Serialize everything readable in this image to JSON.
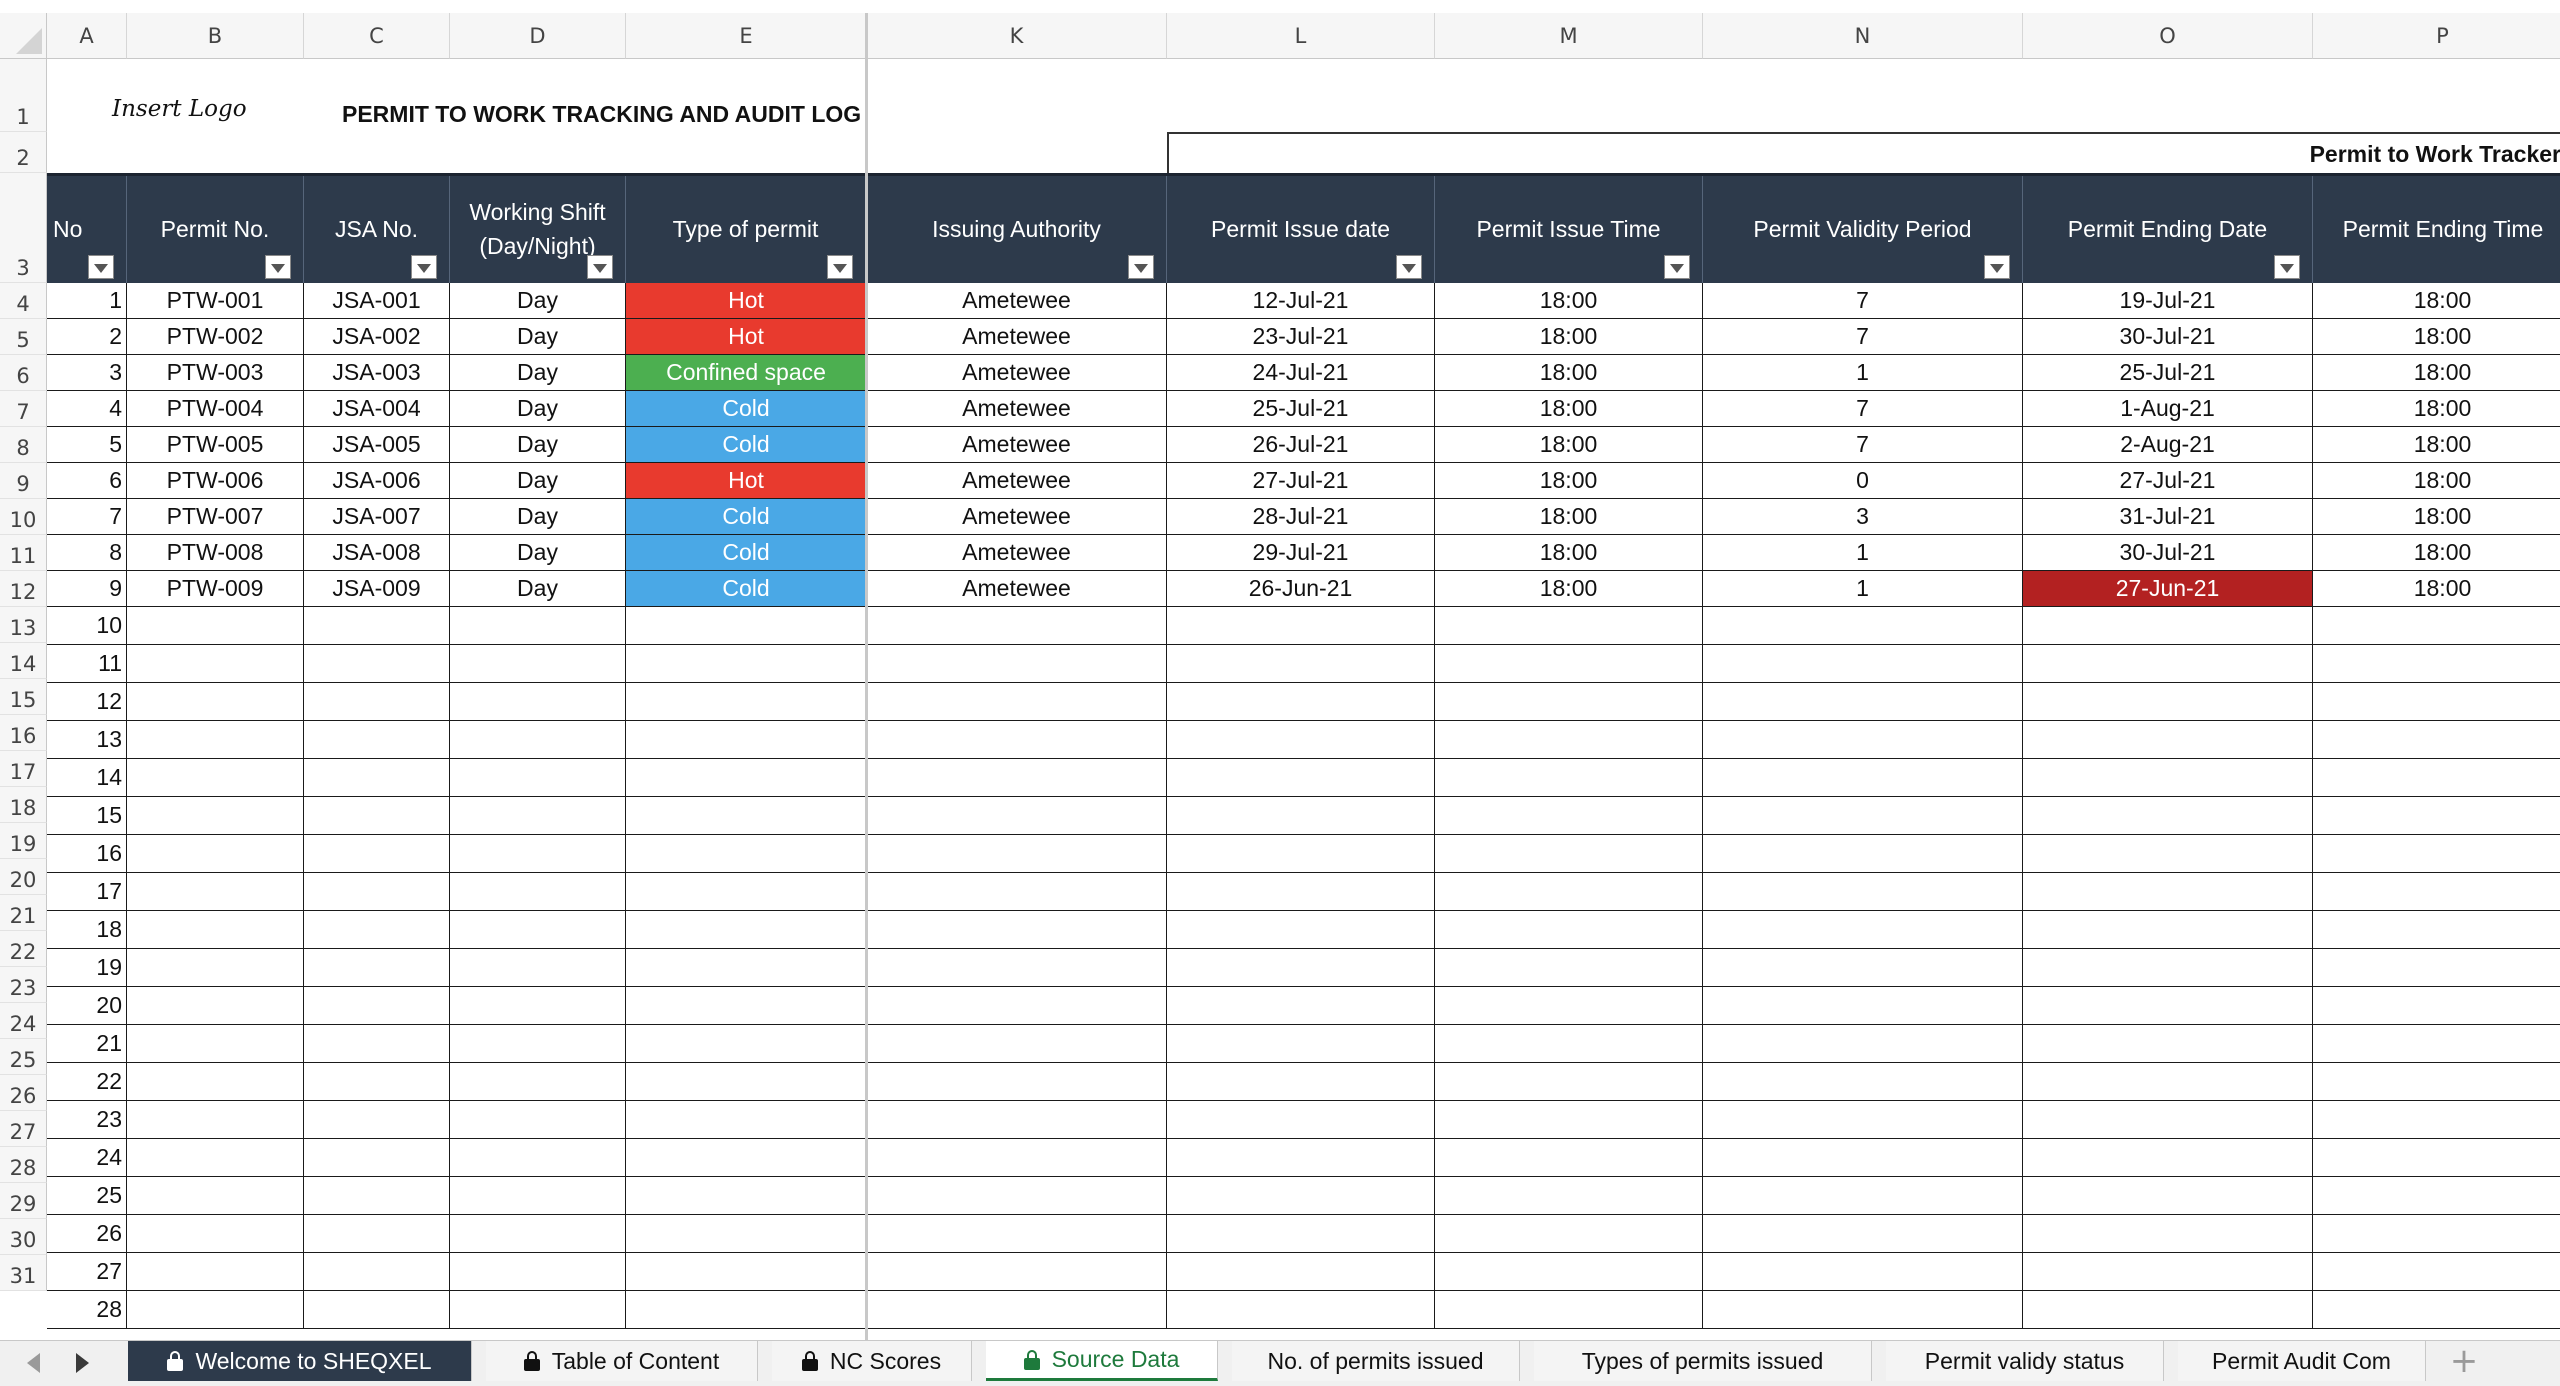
{
  "app": {
    "sheet_title": "PERMIT TO WORK TRACKING AND AUDIT LOG",
    "logo_text": "Insert Logo",
    "tracker_label": "Permit to Work Tracker"
  },
  "columns": [
    "A",
    "B",
    "C",
    "D",
    "E",
    "K",
    "L",
    "M",
    "N",
    "O",
    "P"
  ],
  "row_numbers": [
    "1",
    "2",
    "3",
    "4",
    "5",
    "6",
    "7",
    "8",
    "9",
    "10",
    "11",
    "12",
    "13",
    "14",
    "15",
    "16",
    "17",
    "18",
    "19",
    "20",
    "21",
    "22",
    "23",
    "24",
    "25",
    "26",
    "27",
    "28",
    "29",
    "30",
    "31"
  ],
  "headers": {
    "no": "No",
    "permit_no": "Permit No.",
    "jsa_no": "JSA No.",
    "working_shift_l1": "Working Shift",
    "working_shift_l2": "(Day/Night)",
    "type_of_permit": "Type of permit",
    "issuing_authority": "Issuing Authority",
    "permit_issue_date": "Permit Issue date",
    "permit_issue_time": "Permit Issue Time",
    "permit_validity_period": "Permit Validity Period",
    "permit_ending_date": "Permit Ending Date",
    "permit_ending_time": "Permit Ending Time"
  },
  "rows": [
    {
      "no": "1",
      "permit": "PTW-001",
      "jsa": "JSA-001",
      "shift": "Day",
      "type": "Hot",
      "authority": "Ametewee",
      "issue_date": "12-Jul-21",
      "issue_time": "18:00",
      "validity": "7",
      "end_date": "19-Jul-21",
      "end_time": "18:00"
    },
    {
      "no": "2",
      "permit": "PTW-002",
      "jsa": "JSA-002",
      "shift": "Day",
      "type": "Hot",
      "authority": "Ametewee",
      "issue_date": "23-Jul-21",
      "issue_time": "18:00",
      "validity": "7",
      "end_date": "30-Jul-21",
      "end_time": "18:00"
    },
    {
      "no": "3",
      "permit": "PTW-003",
      "jsa": "JSA-003",
      "shift": "Day",
      "type": "Confined space",
      "authority": "Ametewee",
      "issue_date": "24-Jul-21",
      "issue_time": "18:00",
      "validity": "1",
      "end_date": "25-Jul-21",
      "end_time": "18:00"
    },
    {
      "no": "4",
      "permit": "PTW-004",
      "jsa": "JSA-004",
      "shift": "Day",
      "type": "Cold",
      "authority": "Ametewee",
      "issue_date": "25-Jul-21",
      "issue_time": "18:00",
      "validity": "7",
      "end_date": "1-Aug-21",
      "end_time": "18:00"
    },
    {
      "no": "5",
      "permit": "PTW-005",
      "jsa": "JSA-005",
      "shift": "Day",
      "type": "Cold",
      "authority": "Ametewee",
      "issue_date": "26-Jul-21",
      "issue_time": "18:00",
      "validity": "7",
      "end_date": "2-Aug-21",
      "end_time": "18:00"
    },
    {
      "no": "6",
      "permit": "PTW-006",
      "jsa": "JSA-006",
      "shift": "Day",
      "type": "Hot",
      "authority": "Ametewee",
      "issue_date": "27-Jul-21",
      "issue_time": "18:00",
      "validity": "0",
      "end_date": "27-Jul-21",
      "end_time": "18:00"
    },
    {
      "no": "7",
      "permit": "PTW-007",
      "jsa": "JSA-007",
      "shift": "Day",
      "type": "Cold",
      "authority": "Ametewee",
      "issue_date": "28-Jul-21",
      "issue_time": "18:00",
      "validity": "3",
      "end_date": "31-Jul-21",
      "end_time": "18:00"
    },
    {
      "no": "8",
      "permit": "PTW-008",
      "jsa": "JSA-008",
      "shift": "Day",
      "type": "Cold",
      "authority": "Ametewee",
      "issue_date": "29-Jul-21",
      "issue_time": "18:00",
      "validity": "1",
      "end_date": "30-Jul-21",
      "end_time": "18:00"
    },
    {
      "no": "9",
      "permit": "PTW-009",
      "jsa": "JSA-009",
      "shift": "Day",
      "type": "Cold",
      "authority": "Ametewee",
      "issue_date": "26-Jun-21",
      "issue_time": "18:00",
      "validity": "1",
      "end_date": "27-Jun-21",
      "end_time": "18:00",
      "end_date_expired": true
    }
  ],
  "empty_row_numbers": [
    "10",
    "11",
    "12",
    "13",
    "14",
    "15",
    "16",
    "17",
    "18",
    "19",
    "20",
    "21",
    "22",
    "23",
    "24",
    "25",
    "26",
    "27",
    "28"
  ],
  "colors": {
    "header_band": "#2d3a4b",
    "hot": "#e83a2e",
    "cold": "#4aa8e6",
    "confined_space": "#4caf50",
    "expired": "#b32121",
    "active_tab_text": "#1e7a3c"
  },
  "tabs": [
    {
      "label": "Welcome to SHEQXEL",
      "locked": true,
      "style": "dark",
      "icon": "lock-icon"
    },
    {
      "label": "Table of Content",
      "locked": true,
      "style": "normal",
      "icon": "lock-icon"
    },
    {
      "label": "NC Scores",
      "locked": true,
      "style": "normal",
      "icon": "lock-icon"
    },
    {
      "label": "Source Data",
      "locked": true,
      "style": "active",
      "icon": "lock-icon"
    },
    {
      "label": "No. of permits issued",
      "locked": false,
      "style": "normal"
    },
    {
      "label": "Types of permits issued",
      "locked": false,
      "style": "normal"
    },
    {
      "label": "Permit validy status",
      "locked": false,
      "style": "normal"
    },
    {
      "label": "Permit Audit Com",
      "locked": false,
      "style": "normal"
    }
  ],
  "add_sheet_label": "+"
}
